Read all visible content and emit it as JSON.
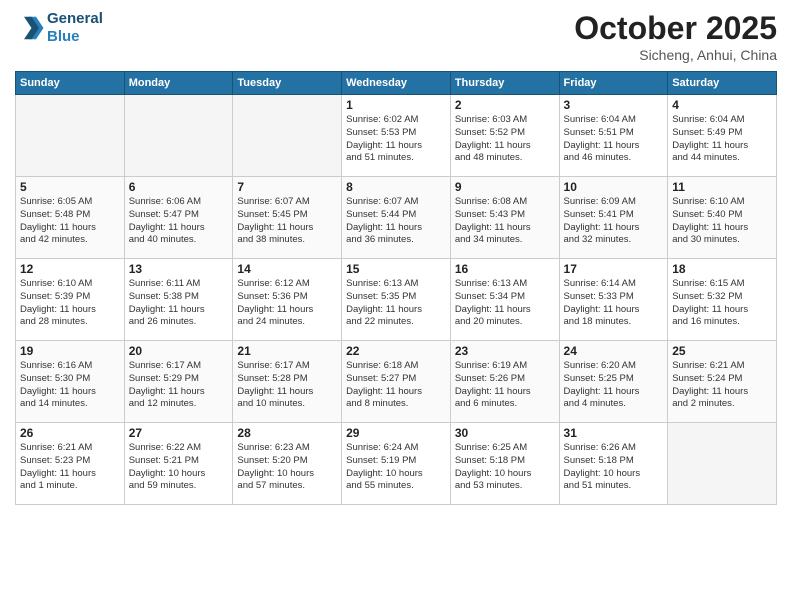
{
  "header": {
    "logo_line1": "General",
    "logo_line2": "Blue",
    "month": "October 2025",
    "location": "Sicheng, Anhui, China"
  },
  "weekdays": [
    "Sunday",
    "Monday",
    "Tuesday",
    "Wednesday",
    "Thursday",
    "Friday",
    "Saturday"
  ],
  "weeks": [
    [
      {
        "day": "",
        "info": ""
      },
      {
        "day": "",
        "info": ""
      },
      {
        "day": "",
        "info": ""
      },
      {
        "day": "1",
        "info": "Sunrise: 6:02 AM\nSunset: 5:53 PM\nDaylight: 11 hours\nand 51 minutes."
      },
      {
        "day": "2",
        "info": "Sunrise: 6:03 AM\nSunset: 5:52 PM\nDaylight: 11 hours\nand 48 minutes."
      },
      {
        "day": "3",
        "info": "Sunrise: 6:04 AM\nSunset: 5:51 PM\nDaylight: 11 hours\nand 46 minutes."
      },
      {
        "day": "4",
        "info": "Sunrise: 6:04 AM\nSunset: 5:49 PM\nDaylight: 11 hours\nand 44 minutes."
      }
    ],
    [
      {
        "day": "5",
        "info": "Sunrise: 6:05 AM\nSunset: 5:48 PM\nDaylight: 11 hours\nand 42 minutes."
      },
      {
        "day": "6",
        "info": "Sunrise: 6:06 AM\nSunset: 5:47 PM\nDaylight: 11 hours\nand 40 minutes."
      },
      {
        "day": "7",
        "info": "Sunrise: 6:07 AM\nSunset: 5:45 PM\nDaylight: 11 hours\nand 38 minutes."
      },
      {
        "day": "8",
        "info": "Sunrise: 6:07 AM\nSunset: 5:44 PM\nDaylight: 11 hours\nand 36 minutes."
      },
      {
        "day": "9",
        "info": "Sunrise: 6:08 AM\nSunset: 5:43 PM\nDaylight: 11 hours\nand 34 minutes."
      },
      {
        "day": "10",
        "info": "Sunrise: 6:09 AM\nSunset: 5:41 PM\nDaylight: 11 hours\nand 32 minutes."
      },
      {
        "day": "11",
        "info": "Sunrise: 6:10 AM\nSunset: 5:40 PM\nDaylight: 11 hours\nand 30 minutes."
      }
    ],
    [
      {
        "day": "12",
        "info": "Sunrise: 6:10 AM\nSunset: 5:39 PM\nDaylight: 11 hours\nand 28 minutes."
      },
      {
        "day": "13",
        "info": "Sunrise: 6:11 AM\nSunset: 5:38 PM\nDaylight: 11 hours\nand 26 minutes."
      },
      {
        "day": "14",
        "info": "Sunrise: 6:12 AM\nSunset: 5:36 PM\nDaylight: 11 hours\nand 24 minutes."
      },
      {
        "day": "15",
        "info": "Sunrise: 6:13 AM\nSunset: 5:35 PM\nDaylight: 11 hours\nand 22 minutes."
      },
      {
        "day": "16",
        "info": "Sunrise: 6:13 AM\nSunset: 5:34 PM\nDaylight: 11 hours\nand 20 minutes."
      },
      {
        "day": "17",
        "info": "Sunrise: 6:14 AM\nSunset: 5:33 PM\nDaylight: 11 hours\nand 18 minutes."
      },
      {
        "day": "18",
        "info": "Sunrise: 6:15 AM\nSunset: 5:32 PM\nDaylight: 11 hours\nand 16 minutes."
      }
    ],
    [
      {
        "day": "19",
        "info": "Sunrise: 6:16 AM\nSunset: 5:30 PM\nDaylight: 11 hours\nand 14 minutes."
      },
      {
        "day": "20",
        "info": "Sunrise: 6:17 AM\nSunset: 5:29 PM\nDaylight: 11 hours\nand 12 minutes."
      },
      {
        "day": "21",
        "info": "Sunrise: 6:17 AM\nSunset: 5:28 PM\nDaylight: 11 hours\nand 10 minutes."
      },
      {
        "day": "22",
        "info": "Sunrise: 6:18 AM\nSunset: 5:27 PM\nDaylight: 11 hours\nand 8 minutes."
      },
      {
        "day": "23",
        "info": "Sunrise: 6:19 AM\nSunset: 5:26 PM\nDaylight: 11 hours\nand 6 minutes."
      },
      {
        "day": "24",
        "info": "Sunrise: 6:20 AM\nSunset: 5:25 PM\nDaylight: 11 hours\nand 4 minutes."
      },
      {
        "day": "25",
        "info": "Sunrise: 6:21 AM\nSunset: 5:24 PM\nDaylight: 11 hours\nand 2 minutes."
      }
    ],
    [
      {
        "day": "26",
        "info": "Sunrise: 6:21 AM\nSunset: 5:23 PM\nDaylight: 11 hours\nand 1 minute."
      },
      {
        "day": "27",
        "info": "Sunrise: 6:22 AM\nSunset: 5:21 PM\nDaylight: 10 hours\nand 59 minutes."
      },
      {
        "day": "28",
        "info": "Sunrise: 6:23 AM\nSunset: 5:20 PM\nDaylight: 10 hours\nand 57 minutes."
      },
      {
        "day": "29",
        "info": "Sunrise: 6:24 AM\nSunset: 5:19 PM\nDaylight: 10 hours\nand 55 minutes."
      },
      {
        "day": "30",
        "info": "Sunrise: 6:25 AM\nSunset: 5:18 PM\nDaylight: 10 hours\nand 53 minutes."
      },
      {
        "day": "31",
        "info": "Sunrise: 6:26 AM\nSunset: 5:18 PM\nDaylight: 10 hours\nand 51 minutes."
      },
      {
        "day": "",
        "info": ""
      }
    ]
  ]
}
